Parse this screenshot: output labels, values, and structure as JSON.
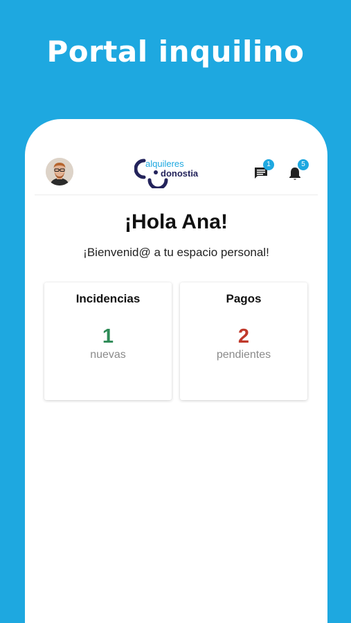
{
  "promo": {
    "title": "Portal inquilino"
  },
  "header": {
    "logo_line1": "alquileres",
    "logo_line2": "donostia",
    "messages_badge": "1",
    "notifications_badge": "5"
  },
  "main": {
    "greeting": "¡Hola Ana!",
    "welcome": "¡Bienvenid@ a tu espacio personal!"
  },
  "cards": [
    {
      "title": "Incidencias",
      "value": "1",
      "label": "nuevas",
      "color": "#2e8b57"
    },
    {
      "title": "Pagos",
      "value": "2",
      "label": "pendientes",
      "color": "#c0392b"
    }
  ],
  "colors": {
    "brand_blue": "#1ea8e0",
    "logo_navy": "#23235b"
  }
}
